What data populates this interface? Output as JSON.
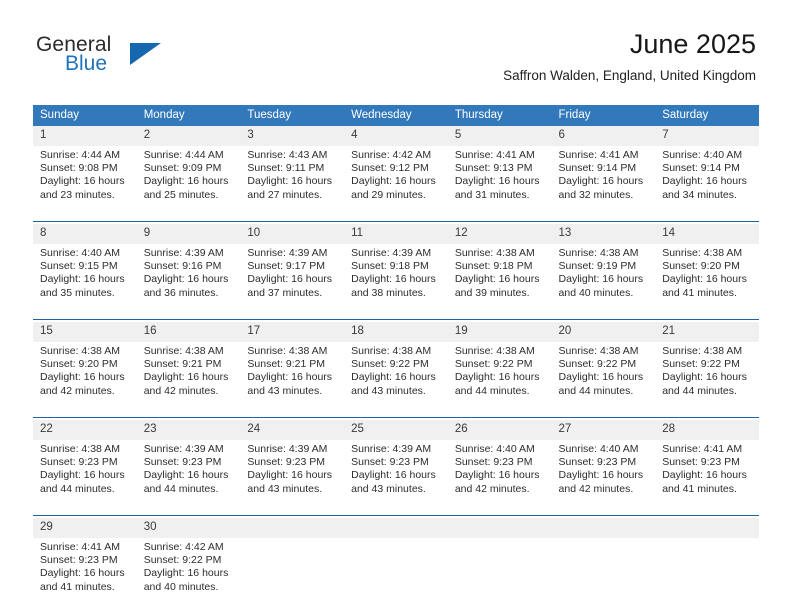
{
  "logo": {
    "word_top": "General",
    "word_bottom": "Blue",
    "triangle_color": "#1568b0",
    "blue_color": "#1f72bd"
  },
  "header": {
    "title": "June 2025",
    "subtitle": "Saffron Walden, England, United Kingdom"
  },
  "theme": {
    "header_bg": "#3279bb",
    "row_rule": "#21619e",
    "daynum_bg": "#f0f0f0"
  },
  "weekdays": [
    "Sunday",
    "Monday",
    "Tuesday",
    "Wednesday",
    "Thursday",
    "Friday",
    "Saturday"
  ],
  "weeks": [
    [
      {
        "day": "1",
        "sunrise": "Sunrise: 4:44 AM",
        "sunset": "Sunset: 9:08 PM",
        "daylight1": "Daylight: 16 hours",
        "daylight2": "and 23 minutes."
      },
      {
        "day": "2",
        "sunrise": "Sunrise: 4:44 AM",
        "sunset": "Sunset: 9:09 PM",
        "daylight1": "Daylight: 16 hours",
        "daylight2": "and 25 minutes."
      },
      {
        "day": "3",
        "sunrise": "Sunrise: 4:43 AM",
        "sunset": "Sunset: 9:11 PM",
        "daylight1": "Daylight: 16 hours",
        "daylight2": "and 27 minutes."
      },
      {
        "day": "4",
        "sunrise": "Sunrise: 4:42 AM",
        "sunset": "Sunset: 9:12 PM",
        "daylight1": "Daylight: 16 hours",
        "daylight2": "and 29 minutes."
      },
      {
        "day": "5",
        "sunrise": "Sunrise: 4:41 AM",
        "sunset": "Sunset: 9:13 PM",
        "daylight1": "Daylight: 16 hours",
        "daylight2": "and 31 minutes."
      },
      {
        "day": "6",
        "sunrise": "Sunrise: 4:41 AM",
        "sunset": "Sunset: 9:14 PM",
        "daylight1": "Daylight: 16 hours",
        "daylight2": "and 32 minutes."
      },
      {
        "day": "7",
        "sunrise": "Sunrise: 4:40 AM",
        "sunset": "Sunset: 9:14 PM",
        "daylight1": "Daylight: 16 hours",
        "daylight2": "and 34 minutes."
      }
    ],
    [
      {
        "day": "8",
        "sunrise": "Sunrise: 4:40 AM",
        "sunset": "Sunset: 9:15 PM",
        "daylight1": "Daylight: 16 hours",
        "daylight2": "and 35 minutes."
      },
      {
        "day": "9",
        "sunrise": "Sunrise: 4:39 AM",
        "sunset": "Sunset: 9:16 PM",
        "daylight1": "Daylight: 16 hours",
        "daylight2": "and 36 minutes."
      },
      {
        "day": "10",
        "sunrise": "Sunrise: 4:39 AM",
        "sunset": "Sunset: 9:17 PM",
        "daylight1": "Daylight: 16 hours",
        "daylight2": "and 37 minutes."
      },
      {
        "day": "11",
        "sunrise": "Sunrise: 4:39 AM",
        "sunset": "Sunset: 9:18 PM",
        "daylight1": "Daylight: 16 hours",
        "daylight2": "and 38 minutes."
      },
      {
        "day": "12",
        "sunrise": "Sunrise: 4:38 AM",
        "sunset": "Sunset: 9:18 PM",
        "daylight1": "Daylight: 16 hours",
        "daylight2": "and 39 minutes."
      },
      {
        "day": "13",
        "sunrise": "Sunrise: 4:38 AM",
        "sunset": "Sunset: 9:19 PM",
        "daylight1": "Daylight: 16 hours",
        "daylight2": "and 40 minutes."
      },
      {
        "day": "14",
        "sunrise": "Sunrise: 4:38 AM",
        "sunset": "Sunset: 9:20 PM",
        "daylight1": "Daylight: 16 hours",
        "daylight2": "and 41 minutes."
      }
    ],
    [
      {
        "day": "15",
        "sunrise": "Sunrise: 4:38 AM",
        "sunset": "Sunset: 9:20 PM",
        "daylight1": "Daylight: 16 hours",
        "daylight2": "and 42 minutes."
      },
      {
        "day": "16",
        "sunrise": "Sunrise: 4:38 AM",
        "sunset": "Sunset: 9:21 PM",
        "daylight1": "Daylight: 16 hours",
        "daylight2": "and 42 minutes."
      },
      {
        "day": "17",
        "sunrise": "Sunrise: 4:38 AM",
        "sunset": "Sunset: 9:21 PM",
        "daylight1": "Daylight: 16 hours",
        "daylight2": "and 43 minutes."
      },
      {
        "day": "18",
        "sunrise": "Sunrise: 4:38 AM",
        "sunset": "Sunset: 9:22 PM",
        "daylight1": "Daylight: 16 hours",
        "daylight2": "and 43 minutes."
      },
      {
        "day": "19",
        "sunrise": "Sunrise: 4:38 AM",
        "sunset": "Sunset: 9:22 PM",
        "daylight1": "Daylight: 16 hours",
        "daylight2": "and 44 minutes."
      },
      {
        "day": "20",
        "sunrise": "Sunrise: 4:38 AM",
        "sunset": "Sunset: 9:22 PM",
        "daylight1": "Daylight: 16 hours",
        "daylight2": "and 44 minutes."
      },
      {
        "day": "21",
        "sunrise": "Sunrise: 4:38 AM",
        "sunset": "Sunset: 9:22 PM",
        "daylight1": "Daylight: 16 hours",
        "daylight2": "and 44 minutes."
      }
    ],
    [
      {
        "day": "22",
        "sunrise": "Sunrise: 4:38 AM",
        "sunset": "Sunset: 9:23 PM",
        "daylight1": "Daylight: 16 hours",
        "daylight2": "and 44 minutes."
      },
      {
        "day": "23",
        "sunrise": "Sunrise: 4:39 AM",
        "sunset": "Sunset: 9:23 PM",
        "daylight1": "Daylight: 16 hours",
        "daylight2": "and 44 minutes."
      },
      {
        "day": "24",
        "sunrise": "Sunrise: 4:39 AM",
        "sunset": "Sunset: 9:23 PM",
        "daylight1": "Daylight: 16 hours",
        "daylight2": "and 43 minutes."
      },
      {
        "day": "25",
        "sunrise": "Sunrise: 4:39 AM",
        "sunset": "Sunset: 9:23 PM",
        "daylight1": "Daylight: 16 hours",
        "daylight2": "and 43 minutes."
      },
      {
        "day": "26",
        "sunrise": "Sunrise: 4:40 AM",
        "sunset": "Sunset: 9:23 PM",
        "daylight1": "Daylight: 16 hours",
        "daylight2": "and 42 minutes."
      },
      {
        "day": "27",
        "sunrise": "Sunrise: 4:40 AM",
        "sunset": "Sunset: 9:23 PM",
        "daylight1": "Daylight: 16 hours",
        "daylight2": "and 42 minutes."
      },
      {
        "day": "28",
        "sunrise": "Sunrise: 4:41 AM",
        "sunset": "Sunset: 9:23 PM",
        "daylight1": "Daylight: 16 hours",
        "daylight2": "and 41 minutes."
      }
    ],
    [
      {
        "day": "29",
        "sunrise": "Sunrise: 4:41 AM",
        "sunset": "Sunset: 9:23 PM",
        "daylight1": "Daylight: 16 hours",
        "daylight2": "and 41 minutes."
      },
      {
        "day": "30",
        "sunrise": "Sunrise: 4:42 AM",
        "sunset": "Sunset: 9:22 PM",
        "daylight1": "Daylight: 16 hours",
        "daylight2": "and 40 minutes."
      },
      {
        "day": "",
        "sunrise": "",
        "sunset": "",
        "daylight1": "",
        "daylight2": ""
      },
      {
        "day": "",
        "sunrise": "",
        "sunset": "",
        "daylight1": "",
        "daylight2": ""
      },
      {
        "day": "",
        "sunrise": "",
        "sunset": "",
        "daylight1": "",
        "daylight2": ""
      },
      {
        "day": "",
        "sunrise": "",
        "sunset": "",
        "daylight1": "",
        "daylight2": ""
      },
      {
        "day": "",
        "sunrise": "",
        "sunset": "",
        "daylight1": "",
        "daylight2": ""
      }
    ]
  ]
}
